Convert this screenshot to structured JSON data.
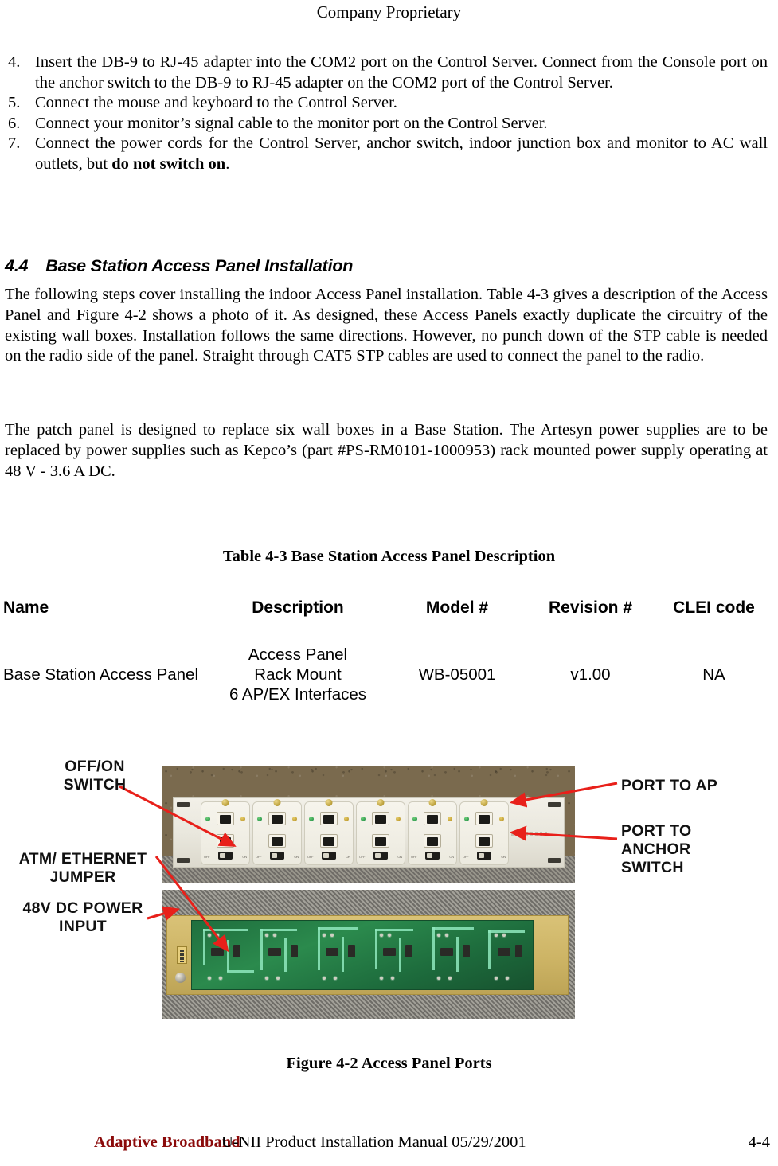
{
  "header": {
    "title": "Company Proprietary"
  },
  "steps": [
    {
      "number": "4.",
      "text": "Insert the DB-9 to RJ-45 adapter into the COM2 port on the Control Server. Connect from the Console port on the anchor switch to the DB-9 to RJ-45 adapter on the COM2 port of the Control Server."
    },
    {
      "number": "5.",
      "text": "Connect the mouse and keyboard to the Control Server."
    },
    {
      "number": "6.",
      "text": "Connect your monitor’s signal cable to the monitor port on the Control Server."
    },
    {
      "number": "7.",
      "text_before_bold": "Connect the power cords for the Control Server, anchor switch, indoor junction box and monitor to AC wall outlets, but ",
      "bold_text": "do not switch on",
      "text_after_bold": "."
    }
  ],
  "section": {
    "number": "4.4",
    "title": "Base Station Access Panel Installation",
    "paragraph_1": "The following steps cover installing the indoor Access Panel installation.  Table 4-3 gives a description of the Access Panel and Figure 4-2 shows a photo of it.  As designed, these Access Panels exactly duplicate the circuitry of the existing wall boxes. Installation follows the same directions. However, no punch down of the STP cable is needed on the radio side of the panel. Straight through CAT5 STP cables are used to connect the panel to the radio.",
    "paragraph_2": "The patch panel is designed to replace six wall boxes in a Base Station.  The Artesyn power supplies are to be replaced by power supplies such as Kepco’s (part #PS-RM0101-1000953) rack mounted power supply operating at 48 V - 3.6 A DC."
  },
  "table": {
    "caption": "Table 4-3  Base Station Access Panel Description",
    "columns": [
      "Name",
      "Description",
      "Model #",
      "Revision #",
      "CLEI code"
    ],
    "rows": [
      {
        "name": "Base Station Access Panel",
        "description_lines": [
          "Access Panel",
          "Rack Mount",
          "6 AP/EX Interfaces"
        ],
        "model": "WB-05001",
        "revision": "v1.00",
        "clei": "NA"
      }
    ]
  },
  "figure": {
    "caption": "Figure 4-2 Access Panel Ports",
    "callouts": {
      "off_on_switch": "OFF/ON\nSWITCH",
      "atm_ethernet_jumper": "ATM/ ETHERNET\nJUMPER",
      "dc_power_input": "48V DC POWER\nINPUT",
      "port_to_ap": "PORT TO AP",
      "port_to_anchor_switch": "PORT TO\nANCHOR\nSWITCH"
    },
    "colors": {
      "arrow": "#e8201a",
      "panel_background": "#7a6a4e",
      "pcb_green": "#23793f",
      "pcb_rail": "#cdb465"
    },
    "module_count": 6,
    "switch_labels": {
      "off": "OFF",
      "on": "ON"
    }
  },
  "footer": {
    "brand": "Adaptive Broadband",
    "manual": "U-NII Product Installation Manual  05/29/2001",
    "page": "4-4",
    "brand_color": "#8b0a0a"
  }
}
